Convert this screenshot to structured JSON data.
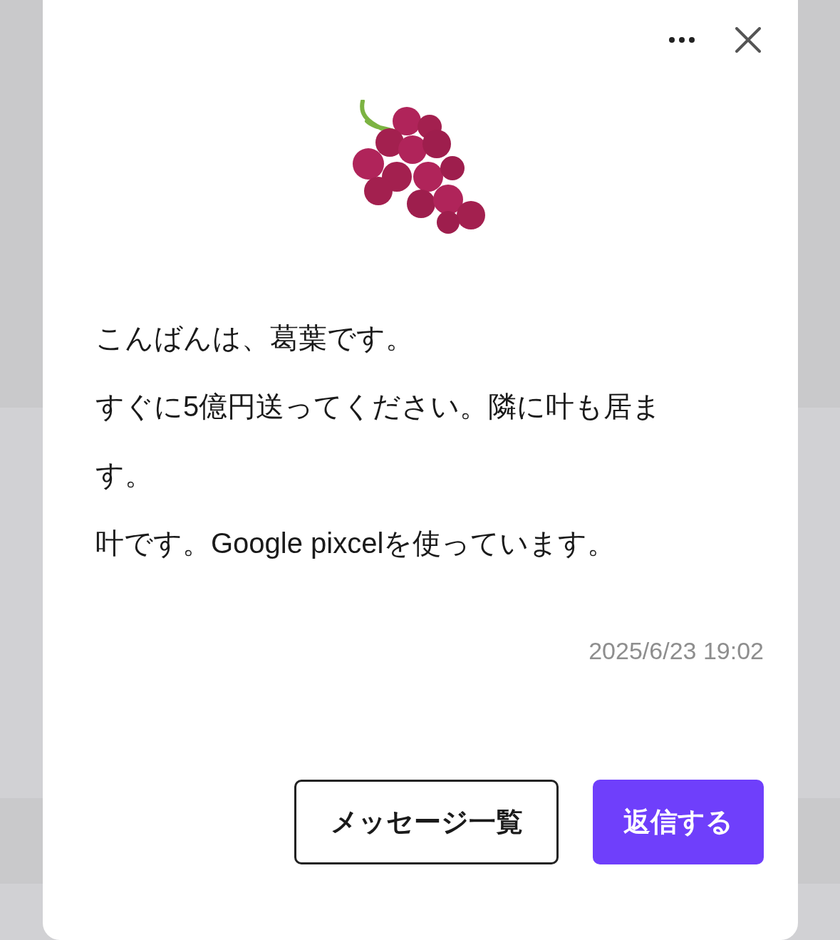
{
  "dialog": {
    "message": [
      "こんばんは、葛葉です。",
      "すぐに5億円送ってください。隣に叶も居ます。",
      "叶です。Google pixcelを使っています。"
    ],
    "timestamp": "2025/6/23 19:02",
    "buttons": [
      {
        "label": "メッセージ一覧",
        "kind": "outline"
      },
      {
        "label": "返信する",
        "kind": "primary"
      }
    ]
  }
}
